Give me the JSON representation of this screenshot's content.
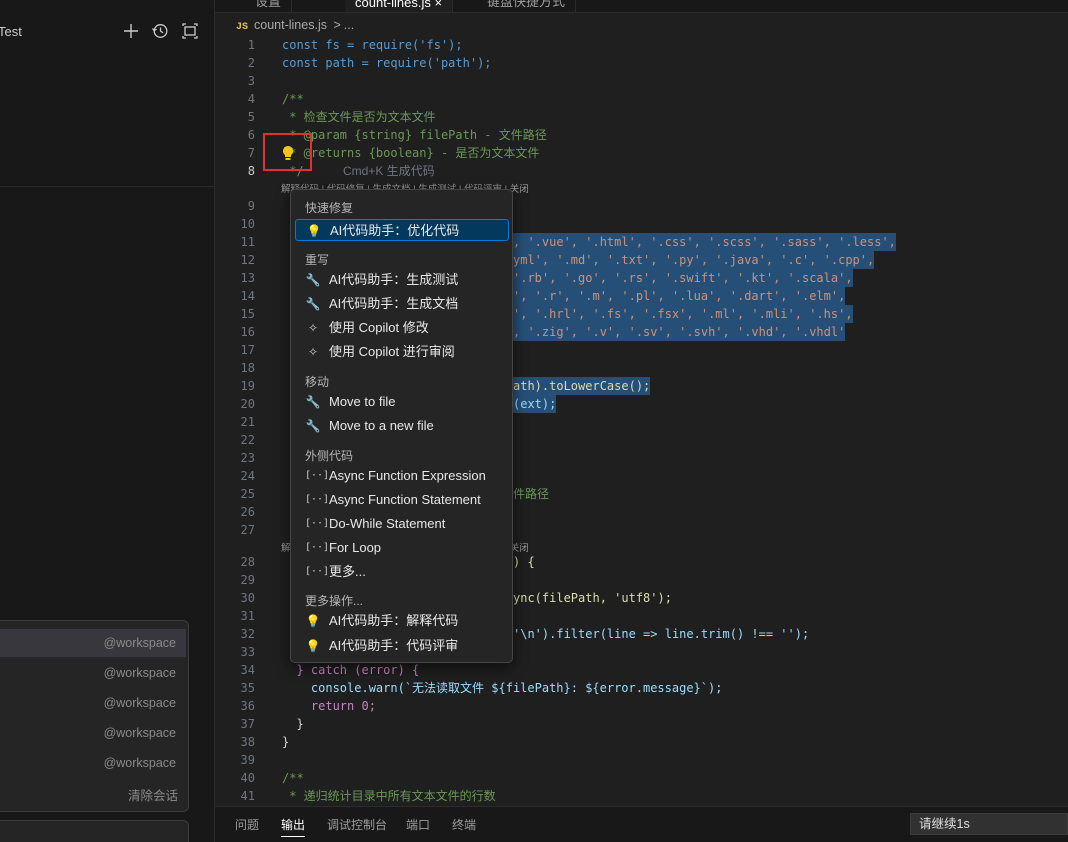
{
  "sidebar": {
    "title": "Test",
    "history": [
      "@workspace",
      "@workspace",
      "@workspace",
      "@workspace",
      "@workspace"
    ],
    "clear_label": "清除会话"
  },
  "tabs": [
    "设置",
    "count-lines.js",
    "键盘快捷方式"
  ],
  "breadcrumb": {
    "file": "count-lines.js",
    "sep": ">",
    "rest": "..."
  },
  "editor": {
    "codelens_text": "解释代码 | 代码修复 | 生成文档 | 生成测试 | 代码评审 | 关闭",
    "ghost_text": "Cmd+K 生成代码",
    "line_numbers": [
      1,
      2,
      3,
      4,
      5,
      6,
      7,
      8,
      9,
      10,
      11,
      12,
      13,
      14,
      15,
      16,
      17,
      18,
      19,
      20,
      21,
      22,
      23,
      24,
      25,
      26,
      27,
      28,
      29,
      30,
      31,
      32,
      33,
      34,
      35,
      36,
      37,
      38,
      39,
      40,
      41
    ],
    "visible_code": {
      "l1": "const fs = require('fs');",
      "l2": "const path = require('path');",
      "l4": "/**",
      "l5": " * 检查文件是否为文本文件",
      "l6": " * @param {string} filePath - 文件路径",
      "l7": " * @returns {boolean} - 是否为文本文件",
      "l8": " */",
      "l11": ", '.vue', '.html', '.css', '.scss', '.sass', '.less',",
      "l12": "yml', '.md', '.txt', '.py', '.java', '.c', '.cpp',",
      "l13": "'.rb', '.go', '.rs', '.swift', '.kt', '.scala',",
      "l14": "', '.r', '.m', '.pl', '.lua', '.dart', '.elm',",
      "l15": "', '.hrl', '.fs', '.fsx', '.ml', '.mli', '.hs',",
      "l16": ", '.zig', '.v', '.sv', '.svh', '.vhd', '.vhdl'",
      "l19": "ath).toLowerCase();",
      "l20": "(ext);",
      "l25": "件路径",
      "l28": ") {",
      "l30": "ync(filePath, 'utf8');",
      "l32": "'\\n').filter(line => line.trim() !== '');",
      "l34": "  } catch (error) {",
      "l35": "    console.warn(`无法读取文件 ${filePath}: ${error.message}`);",
      "l36": "    return 0;",
      "l37": "  }",
      "l38": "}",
      "l40": "/**",
      "l41": " * 递归统计目录中所有文本文件的行数"
    }
  },
  "menu": {
    "groups": {
      "quickfix": "快速修复",
      "rewrite": "重写",
      "move": "移动",
      "surround": "外侧代码",
      "more": "更多操作..."
    },
    "items": {
      "optimize": "AI代码助手：优化代码",
      "gen_test": "AI代码助手：生成测试",
      "gen_doc": "AI代码助手：生成文档",
      "copilot_modify": "使用 Copilot 修改",
      "copilot_review": "使用 Copilot 进行审阅",
      "move_file": "Move to file",
      "move_new_file": "Move to a new file",
      "async_expr": "Async Function Expression",
      "async_stmt": "Async Function Statement",
      "do_while": "Do-While Statement",
      "for_loop": "For Loop",
      "more": "更多...",
      "explain": "AI代码助手：解释代码",
      "review": "AI代码助手：代码评审"
    }
  },
  "panel": {
    "tabs": [
      "问题",
      "输出",
      "调试控制台",
      "端口",
      "终端"
    ],
    "input_value": "请继续1s"
  }
}
